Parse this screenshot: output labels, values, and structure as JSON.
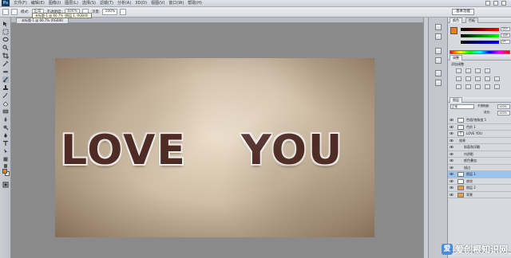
{
  "app": {
    "logo": "Ps"
  },
  "menu": {
    "items": [
      "文件(F)",
      "编辑(E)",
      "图像(I)",
      "图层(L)",
      "选择(S)",
      "滤镜(T)",
      "分析(A)",
      "3D(D)",
      "视图(V)",
      "窗口(W)",
      "帮助(H)"
    ]
  },
  "options": {
    "mode_label": "模式:",
    "mode_value": "正常",
    "opacity_label": "不透明度:",
    "opacity_value": "100%",
    "flow_label": "流量:",
    "flow_value": "100%",
    "workspace": "基本功能"
  },
  "document": {
    "tab_label": "未标题-1 @ 66.7% (RGB/8)",
    "tooltip": "未标题-1 @ 66.7% (图层 1, RGB/8)"
  },
  "canvas": {
    "word1": "LOVE",
    "word2": "YOU"
  },
  "panels": {
    "color_tab": "颜色",
    "swatch_tab": "色板",
    "slider_values": [
      "255",
      "128",
      "29"
    ],
    "adjust_tab": "调整",
    "adjust_title": "添加调整",
    "layers_tab": "图层",
    "blend_mode": "正常",
    "opacity_label": "不透明度:",
    "opacity_value": "100%",
    "fill_label": "填充:",
    "fill_value": "100%",
    "layers": [
      {
        "name": "色相/饱和度 1",
        "selected": false
      },
      {
        "name": "色阶 1",
        "selected": false
      },
      {
        "name": "LOVE   YOU",
        "selected": false
      },
      {
        "name": "效果",
        "selected": false
      },
      {
        "name": "斜面和浮雕",
        "selected": false
      },
      {
        "name": "内阴影",
        "selected": false
      },
      {
        "name": "颜色叠加",
        "selected": false
      },
      {
        "name": "描边",
        "selected": false
      },
      {
        "name": "图层 1",
        "selected": true
      },
      {
        "name": "底纹",
        "selected": false
      },
      {
        "name": "图层 2",
        "selected": false
      },
      {
        "name": "背景",
        "selected": false
      }
    ]
  },
  "watermark": {
    "logo": "爱",
    "text": "爱创根知识网"
  },
  "colors": {
    "foreground": "#e87f1d",
    "text": "#4d2a24",
    "selection": "#9cc3ec"
  }
}
